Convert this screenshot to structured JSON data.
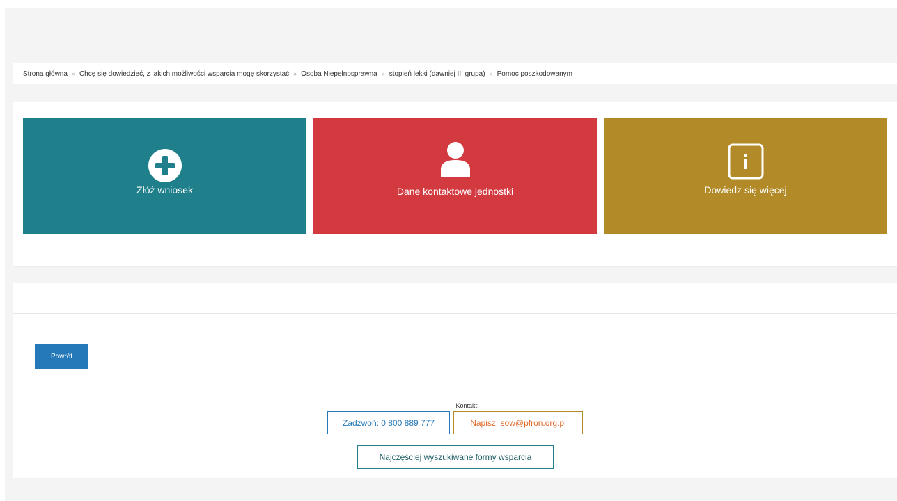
{
  "breadcrumb": {
    "items": [
      {
        "label": "Strona główna"
      },
      {
        "label": "Chcę się dowiedzieć, z jakich możliwości wsparcia mogę skorzystać"
      },
      {
        "label": "Osoba Niepełnosprawna"
      },
      {
        "label": "stopień lekki (dawniej III grupa)"
      },
      {
        "label": "Pomoc poszkodowanym"
      }
    ],
    "separator": "»"
  },
  "tiles": [
    {
      "label": "Złóż wniosek",
      "icon": "plus-circle-icon",
      "color": "#1f7f8a"
    },
    {
      "label": "Dane kontaktowe jednostki",
      "icon": "user-icon",
      "color": "#d33a40"
    },
    {
      "label": "Dowiedz się więcej",
      "icon": "info-icon",
      "color": "#b38a28"
    }
  ],
  "back_button": {
    "label": "Powrót"
  },
  "contact": {
    "label": "Kontakt:",
    "call": "Zadzwoń: 0 800 889 777",
    "mail": "Napisz: sow@pfron.org.pl",
    "forms": "Najczęściej wyszukiwane formy wsparcia"
  },
  "colors": {
    "primary_blue": "#2579b8",
    "teal": "#1f7f8a",
    "red": "#d33a40",
    "gold": "#b38a28"
  }
}
